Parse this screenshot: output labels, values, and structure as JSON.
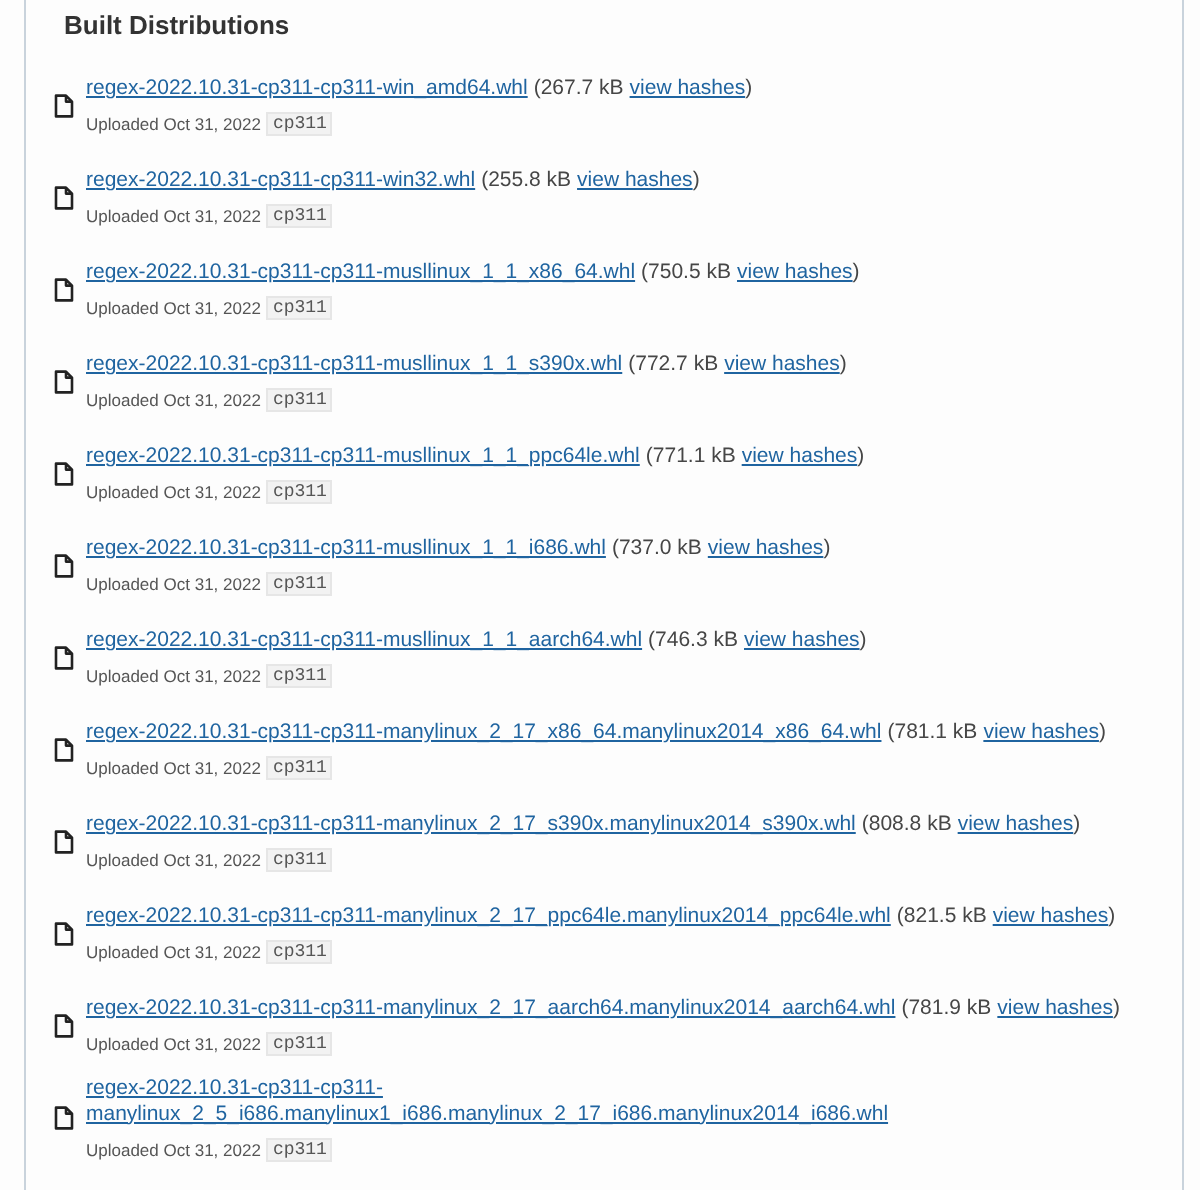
{
  "section_title": "Built Distributions",
  "files": [
    {
      "filename": "regex-2022.10.31-cp311-cp311-win_amd64.whl",
      "size": "(267.7 kB",
      "hashes_link": "view hashes",
      "close": ")",
      "uploaded": "Uploaded Oct 31, 2022",
      "tag": "cp311"
    },
    {
      "filename": "regex-2022.10.31-cp311-cp311-win32.whl",
      "size": "(255.8 kB",
      "hashes_link": "view hashes",
      "close": ")",
      "uploaded": "Uploaded Oct 31, 2022",
      "tag": "cp311"
    },
    {
      "filename": "regex-2022.10.31-cp311-cp311-musllinux_1_1_x86_64.whl",
      "size": "(750.5 kB",
      "hashes_link": "view hashes",
      "close": ")",
      "uploaded": "Uploaded Oct 31, 2022",
      "tag": "cp311"
    },
    {
      "filename": "regex-2022.10.31-cp311-cp311-musllinux_1_1_s390x.whl",
      "size": "(772.7 kB",
      "hashes_link": "view hashes",
      "close": ")",
      "uploaded": "Uploaded Oct 31, 2022",
      "tag": "cp311"
    },
    {
      "filename": "regex-2022.10.31-cp311-cp311-musllinux_1_1_ppc64le.whl",
      "size": "(771.1 kB",
      "hashes_link": "view hashes",
      "close": ")",
      "uploaded": "Uploaded Oct 31, 2022",
      "tag": "cp311"
    },
    {
      "filename": "regex-2022.10.31-cp311-cp311-musllinux_1_1_i686.whl",
      "size": "(737.0 kB",
      "hashes_link": "view hashes",
      "close": ")",
      "uploaded": "Uploaded Oct 31, 2022",
      "tag": "cp311"
    },
    {
      "filename": "regex-2022.10.31-cp311-cp311-musllinux_1_1_aarch64.whl",
      "size": "(746.3 kB",
      "hashes_link": "view hashes",
      "close": ")",
      "uploaded": "Uploaded Oct 31, 2022",
      "tag": "cp311"
    },
    {
      "filename": "regex-2022.10.31-cp311-cp311-manylinux_2_17_x86_64.manylinux2014_x86_64.whl",
      "size": "(781.1 kB",
      "hashes_link": "view hashes",
      "close": ")",
      "uploaded": "Uploaded Oct 31, 2022",
      "tag": "cp311"
    },
    {
      "filename": "regex-2022.10.31-cp311-cp311-manylinux_2_17_s390x.manylinux2014_s390x.whl",
      "size": "(808.8 kB",
      "hashes_link": "view hashes",
      "close": ")",
      "uploaded": "Uploaded Oct 31, 2022",
      "tag": "cp311"
    },
    {
      "filename": "regex-2022.10.31-cp311-cp311-manylinux_2_17_ppc64le.manylinux2014_ppc64le.whl",
      "size": "(821.5 kB",
      "hashes_link": "view hashes",
      "close": ")",
      "uploaded": "Uploaded Oct 31, 2022",
      "tag": "cp311"
    },
    {
      "filename": "regex-2022.10.31-cp311-cp311-manylinux_2_17_aarch64.manylinux2014_aarch64.whl",
      "size": "(781.9 kB",
      "hashes_link": "view hashes",
      "close": ")",
      "uploaded": "Uploaded Oct 31, 2022",
      "tag": "cp311"
    },
    {
      "filename": "regex-2022.10.31-cp311-cp311-manylinux_2_5_i686.manylinux1_i686.manylinux_2_17_i686.manylinux2014_i686.whl",
      "uploaded": "Uploaded Oct 31, 2022",
      "tag": "cp311"
    }
  ]
}
